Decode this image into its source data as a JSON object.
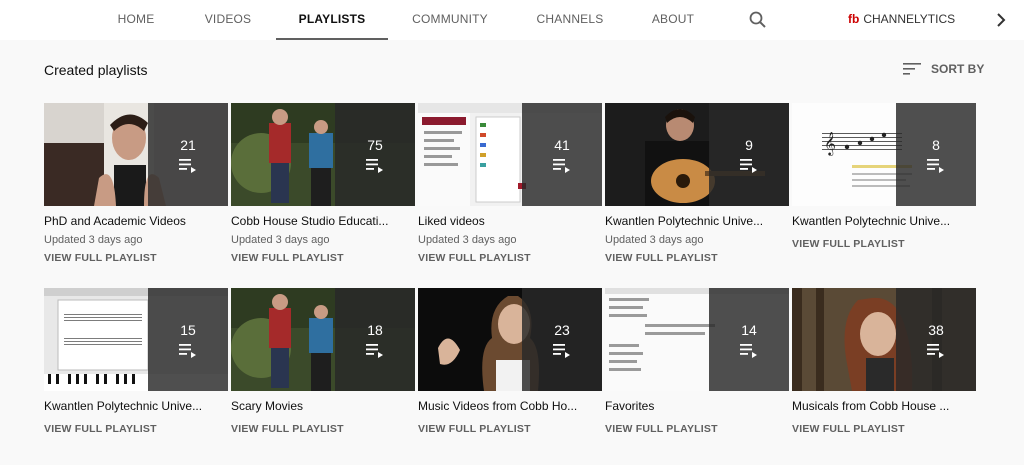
{
  "tabs": [
    "HOME",
    "VIDEOS",
    "PLAYLISTS",
    "COMMUNITY",
    "CHANNELS",
    "ABOUT"
  ],
  "active_tab": "PLAYLISTS",
  "channelytics": {
    "logo": "fb",
    "label": "CHANNELYTICS"
  },
  "section_title": "Created playlists",
  "sort_label": "SORT BY",
  "view_full_label": "VIEW FULL PLAYLIST",
  "playlists": [
    {
      "title": "PhD and Academic Videos",
      "count": "21",
      "updated": "Updated 3 days ago"
    },
    {
      "title": "Cobb House Studio Educati...",
      "count": "75",
      "updated": "Updated 3 days ago"
    },
    {
      "title": "Liked videos",
      "count": "41",
      "updated": "Updated 3 days ago"
    },
    {
      "title": "Kwantlen Polytechnic Unive...",
      "count": "9",
      "updated": "Updated 3 days ago"
    },
    {
      "title": "Kwantlen Polytechnic Unive...",
      "count": "8",
      "updated": ""
    },
    {
      "title": "Kwantlen Polytechnic Unive...",
      "count": "15",
      "updated": ""
    },
    {
      "title": "Scary Movies",
      "count": "18",
      "updated": ""
    },
    {
      "title": "Music Videos from Cobb Ho...",
      "count": "23",
      "updated": ""
    },
    {
      "title": "Favorites",
      "count": "14",
      "updated": ""
    },
    {
      "title": "Musicals from Cobb House ...",
      "count": "38",
      "updated": ""
    }
  ]
}
